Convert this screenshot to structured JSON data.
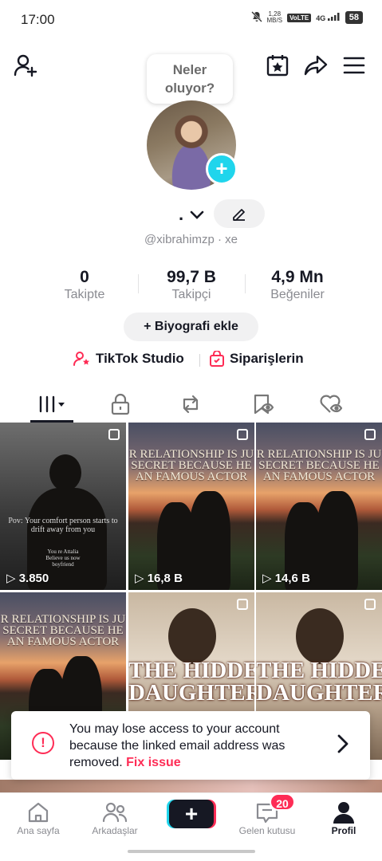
{
  "status_bar": {
    "time": "17:00",
    "net_speed_value": "1,28",
    "net_speed_unit": "MB/S",
    "volte": "VoLTE",
    "signal": "4G",
    "battery": "58"
  },
  "header": {
    "bubble_text_1": "Neler",
    "bubble_text_2": "oluyor?",
    "add_friend_icon": "add-user-icon",
    "calendar_icon": "calendar-star-icon",
    "share_icon": "share-icon",
    "menu_icon": "menu-icon"
  },
  "profile": {
    "display_name": ".",
    "handle": "@xibrahimzp · xe"
  },
  "stats": [
    {
      "value": "0",
      "label": "Takipte"
    },
    {
      "value": "99,7 B",
      "label": "Takipçi"
    },
    {
      "value": "4,9 Mn",
      "label": "Beğeniler"
    }
  ],
  "bio_button": "+ Biyografi ekle",
  "links": {
    "studio": "TikTok Studio",
    "orders": "Siparişlerin"
  },
  "grid": {
    "cells": [
      {
        "views": "3.850",
        "caption": "Pov: Your comfort person starts to drift away from you",
        "sub": "You re Attalia Believe us now boyfriend"
      },
      {
        "views": "16,8 B",
        "line1": "R RELATIONSHIP IS JU",
        "line2": "SECRET BECAUSE HE",
        "line3": "AN FAMOUS ACTOR"
      },
      {
        "views": "14,6 B",
        "line1": "R RELATIONSHIP IS JU",
        "line2": "SECRET BECAUSE HE",
        "line3": "AN FAMOUS ACTOR"
      },
      {
        "line1": "R RELATIONSHIP IS JU",
        "line2": "SECRET BECAUSE HE",
        "line3": "AN FAMOUS ACTOR"
      },
      {
        "line1": "THE HIDDEN",
        "line2": "DAUGHTER"
      },
      {
        "line1": "THE HIDDEN",
        "line2": "DAUGHTER"
      }
    ]
  },
  "banner": {
    "text": "You may lose access to your account because the linked email address was removed.",
    "fix": "Fix issue"
  },
  "nav": {
    "home": "Ana sayfa",
    "friends": "Arkadaşlar",
    "inbox": "Gelen kutusu",
    "inbox_badge": "20",
    "profile": "Profil"
  },
  "colors": {
    "accent_red": "#fe2c55",
    "accent_cyan": "#20d5ec",
    "text_primary": "#161823",
    "text_secondary": "#8a8b91"
  }
}
